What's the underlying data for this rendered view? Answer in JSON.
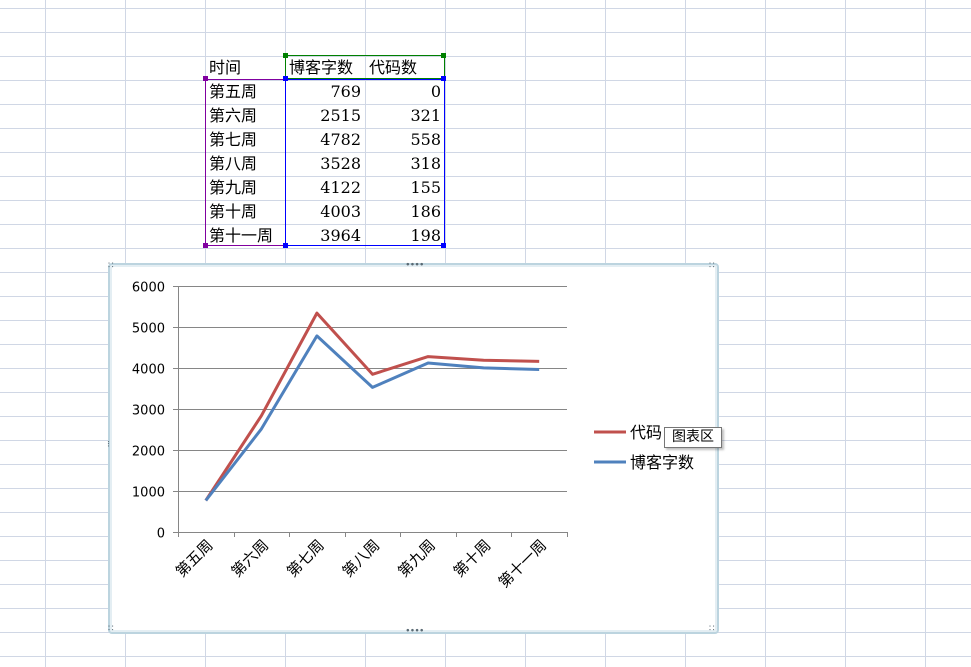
{
  "sheet": {
    "headers": {
      "time": "时间",
      "blog_words": "博客字数",
      "code_count": "代码数"
    },
    "rows": [
      {
        "week": "第五周",
        "blog_words": "769",
        "code_count": "0"
      },
      {
        "week": "第六周",
        "blog_words": "2515",
        "code_count": "321"
      },
      {
        "week": "第七周",
        "blog_words": "4782",
        "code_count": "558"
      },
      {
        "week": "第八周",
        "blog_words": "3528",
        "code_count": "318"
      },
      {
        "week": "第九周",
        "blog_words": "4122",
        "code_count": "155"
      },
      {
        "week": "第十周",
        "blog_words": "4003",
        "code_count": "186"
      },
      {
        "week": "第十一周",
        "blog_words": "3964",
        "code_count": "198"
      }
    ]
  },
  "chart_data": {
    "type": "line",
    "categories": [
      "第五周",
      "第六周",
      "第七周",
      "第八周",
      "第九周",
      "第十周",
      "第十一周"
    ],
    "series": [
      {
        "name": "代码数",
        "color": "#c0504d",
        "values": [
          769,
          2836,
          5340,
          3846,
          4277,
          4189,
          4162
        ]
      },
      {
        "name": "博客字数",
        "color": "#4f81bd",
        "values": [
          769,
          2515,
          4782,
          3528,
          4122,
          4003,
          3964
        ]
      }
    ],
    "yticks": [
      "0",
      "1000",
      "2000",
      "3000",
      "4000",
      "5000",
      "6000"
    ],
    "ylim": [
      0,
      6000
    ],
    "grid": true,
    "legend": "right",
    "legend_visible_labels": [
      "代码",
      "博客字数"
    ]
  },
  "tooltip": {
    "text": "图表区"
  },
  "colors": {
    "gridline": "#d0d7e5",
    "selection_green": "#008000",
    "selection_blue": "#0000ff",
    "selection_purple": "#8000a0",
    "chart_border": "#bcd4df"
  }
}
